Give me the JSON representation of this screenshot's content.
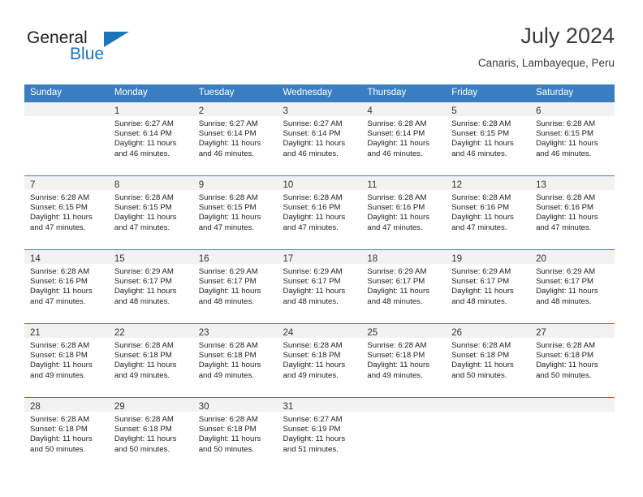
{
  "brand": {
    "name_part1": "General",
    "name_part2": "Blue"
  },
  "header": {
    "month_title": "July 2024",
    "location": "Canaris, Lambayeque, Peru"
  },
  "colors": {
    "header_blue": "#3a7dc0",
    "brand_blue": "#1b75bb",
    "daynum_strip": "#f2f2f2",
    "text": "#222222"
  },
  "weekday_headers": [
    "Sunday",
    "Monday",
    "Tuesday",
    "Wednesday",
    "Thursday",
    "Friday",
    "Saturday"
  ],
  "weeks": [
    [
      {
        "day": "",
        "lines": []
      },
      {
        "day": "1",
        "lines": [
          "Sunrise: 6:27 AM",
          "Sunset: 6:14 PM",
          "Daylight: 11 hours",
          "and 46 minutes."
        ]
      },
      {
        "day": "2",
        "lines": [
          "Sunrise: 6:27 AM",
          "Sunset: 6:14 PM",
          "Daylight: 11 hours",
          "and 46 minutes."
        ]
      },
      {
        "day": "3",
        "lines": [
          "Sunrise: 6:27 AM",
          "Sunset: 6:14 PM",
          "Daylight: 11 hours",
          "and 46 minutes."
        ]
      },
      {
        "day": "4",
        "lines": [
          "Sunrise: 6:28 AM",
          "Sunset: 6:14 PM",
          "Daylight: 11 hours",
          "and 46 minutes."
        ]
      },
      {
        "day": "5",
        "lines": [
          "Sunrise: 6:28 AM",
          "Sunset: 6:15 PM",
          "Daylight: 11 hours",
          "and 46 minutes."
        ]
      },
      {
        "day": "6",
        "lines": [
          "Sunrise: 6:28 AM",
          "Sunset: 6:15 PM",
          "Daylight: 11 hours",
          "and 46 minutes."
        ]
      }
    ],
    [
      {
        "day": "7",
        "lines": [
          "Sunrise: 6:28 AM",
          "Sunset: 6:15 PM",
          "Daylight: 11 hours",
          "and 47 minutes."
        ]
      },
      {
        "day": "8",
        "lines": [
          "Sunrise: 6:28 AM",
          "Sunset: 6:15 PM",
          "Daylight: 11 hours",
          "and 47 minutes."
        ]
      },
      {
        "day": "9",
        "lines": [
          "Sunrise: 6:28 AM",
          "Sunset: 6:15 PM",
          "Daylight: 11 hours",
          "and 47 minutes."
        ]
      },
      {
        "day": "10",
        "lines": [
          "Sunrise: 6:28 AM",
          "Sunset: 6:16 PM",
          "Daylight: 11 hours",
          "and 47 minutes."
        ]
      },
      {
        "day": "11",
        "lines": [
          "Sunrise: 6:28 AM",
          "Sunset: 6:16 PM",
          "Daylight: 11 hours",
          "and 47 minutes."
        ]
      },
      {
        "day": "12",
        "lines": [
          "Sunrise: 6:28 AM",
          "Sunset: 6:16 PM",
          "Daylight: 11 hours",
          "and 47 minutes."
        ]
      },
      {
        "day": "13",
        "lines": [
          "Sunrise: 6:28 AM",
          "Sunset: 6:16 PM",
          "Daylight: 11 hours",
          "and 47 minutes."
        ]
      }
    ],
    [
      {
        "day": "14",
        "lines": [
          "Sunrise: 6:28 AM",
          "Sunset: 6:16 PM",
          "Daylight: 11 hours",
          "and 47 minutes."
        ]
      },
      {
        "day": "15",
        "lines": [
          "Sunrise: 6:29 AM",
          "Sunset: 6:17 PM",
          "Daylight: 11 hours",
          "and 48 minutes."
        ]
      },
      {
        "day": "16",
        "lines": [
          "Sunrise: 6:29 AM",
          "Sunset: 6:17 PM",
          "Daylight: 11 hours",
          "and 48 minutes."
        ]
      },
      {
        "day": "17",
        "lines": [
          "Sunrise: 6:29 AM",
          "Sunset: 6:17 PM",
          "Daylight: 11 hours",
          "and 48 minutes."
        ]
      },
      {
        "day": "18",
        "lines": [
          "Sunrise: 6:29 AM",
          "Sunset: 6:17 PM",
          "Daylight: 11 hours",
          "and 48 minutes."
        ]
      },
      {
        "day": "19",
        "lines": [
          "Sunrise: 6:29 AM",
          "Sunset: 6:17 PM",
          "Daylight: 11 hours",
          "and 48 minutes."
        ]
      },
      {
        "day": "20",
        "lines": [
          "Sunrise: 6:29 AM",
          "Sunset: 6:17 PM",
          "Daylight: 11 hours",
          "and 48 minutes."
        ]
      }
    ],
    [
      {
        "day": "21",
        "lines": [
          "Sunrise: 6:28 AM",
          "Sunset: 6:18 PM",
          "Daylight: 11 hours",
          "and 49 minutes."
        ]
      },
      {
        "day": "22",
        "lines": [
          "Sunrise: 6:28 AM",
          "Sunset: 6:18 PM",
          "Daylight: 11 hours",
          "and 49 minutes."
        ]
      },
      {
        "day": "23",
        "lines": [
          "Sunrise: 6:28 AM",
          "Sunset: 6:18 PM",
          "Daylight: 11 hours",
          "and 49 minutes."
        ]
      },
      {
        "day": "24",
        "lines": [
          "Sunrise: 6:28 AM",
          "Sunset: 6:18 PM",
          "Daylight: 11 hours",
          "and 49 minutes."
        ]
      },
      {
        "day": "25",
        "lines": [
          "Sunrise: 6:28 AM",
          "Sunset: 6:18 PM",
          "Daylight: 11 hours",
          "and 49 minutes."
        ]
      },
      {
        "day": "26",
        "lines": [
          "Sunrise: 6:28 AM",
          "Sunset: 6:18 PM",
          "Daylight: 11 hours",
          "and 50 minutes."
        ]
      },
      {
        "day": "27",
        "lines": [
          "Sunrise: 6:28 AM",
          "Sunset: 6:18 PM",
          "Daylight: 11 hours",
          "and 50 minutes."
        ]
      }
    ],
    [
      {
        "day": "28",
        "lines": [
          "Sunrise: 6:28 AM",
          "Sunset: 6:18 PM",
          "Daylight: 11 hours",
          "and 50 minutes."
        ]
      },
      {
        "day": "29",
        "lines": [
          "Sunrise: 6:28 AM",
          "Sunset: 6:18 PM",
          "Daylight: 11 hours",
          "and 50 minutes."
        ]
      },
      {
        "day": "30",
        "lines": [
          "Sunrise: 6:28 AM",
          "Sunset: 6:18 PM",
          "Daylight: 11 hours",
          "and 50 minutes."
        ]
      },
      {
        "day": "31",
        "lines": [
          "Sunrise: 6:27 AM",
          "Sunset: 6:19 PM",
          "Daylight: 11 hours",
          "and 51 minutes."
        ]
      },
      {
        "day": "",
        "lines": []
      },
      {
        "day": "",
        "lines": []
      },
      {
        "day": "",
        "lines": []
      }
    ]
  ]
}
